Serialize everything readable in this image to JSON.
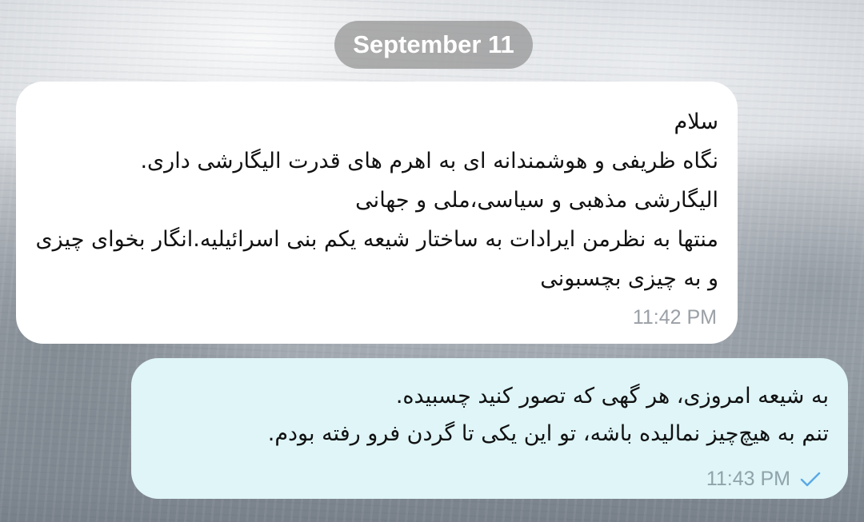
{
  "date_divider": "September 11",
  "messages": [
    {
      "direction": "incoming",
      "text": "سلام\nنگاه ظریفی و هوشمندانه ای به اهرم های قدرت الیگارشی داری.\nالیگارشی مذهبی و سیاسی،ملی و جهانی\nمنتها به نظرمن ایرادات به ساختار شیعه یکم بنی اسرائیلیه.انگار بخوای چیزی و به چیزی بچسبونی",
      "time": "11:42 PM"
    },
    {
      "direction": "outgoing",
      "text": "به شیعه امروزی، هر گهی که تصور کنید چسبیده.\nتنم به هیچ‌چیز نمالیده باشه، تو این یکی تا گردن فرو رفته بودم.",
      "time": "11:43 PM",
      "status_icon": "check-icon"
    }
  ],
  "colors": {
    "incoming_bubble": "#ffffff",
    "outgoing_bubble": "#dff5f8",
    "date_chip": "#919191",
    "checkmark": "#5aa9e6"
  }
}
